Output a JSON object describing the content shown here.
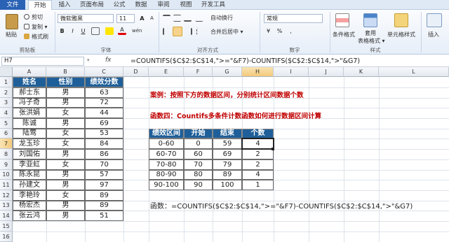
{
  "ribbon": {
    "tabs": [
      "文件",
      "开始",
      "插入",
      "页面布局",
      "公式",
      "数据",
      "审阅",
      "视图",
      "开发工具"
    ],
    "clipboard": {
      "paste": "粘贴",
      "cut": "剪切",
      "copy": "复制 ▾",
      "format_painter": "格式刷",
      "group": "剪贴板"
    },
    "font": {
      "name": "微软雅黑",
      "size": "11",
      "bold": "B",
      "italic": "I",
      "underline": "U",
      "grow": "A",
      "shrink": "A",
      "wen": "wén",
      "group": "字体"
    },
    "alignment": {
      "wrap": "自动换行",
      "merge": "合并后居中 ▾",
      "group": "对齐方式"
    },
    "number": {
      "format": "常规",
      "percent": "%",
      "comma": ",",
      "currency": "¥",
      "group": "数字"
    },
    "styles": {
      "cond": "条件格式",
      "table": "套用",
      "table2": "表格格式 ▾",
      "cell": "单元格样式",
      "group": "样式"
    },
    "insert": "插入"
  },
  "formula_bar": {
    "cell_ref": "H7",
    "fx": "fx",
    "formula": "=COUNTIFS($C$2:$C$14,\">=\"&F7)-COUNTIFS($C$2:$C$14,\">\"&G7)"
  },
  "columns": [
    "A",
    "B",
    "C",
    "D",
    "E",
    "F",
    "G",
    "H",
    "I",
    "J",
    "K",
    "L"
  ],
  "rows": [
    "1",
    "2",
    "3",
    "4",
    "5",
    "6",
    "7",
    "8",
    "9",
    "10",
    "11",
    "12",
    "13",
    "14",
    "15",
    "16"
  ],
  "left_table": {
    "headers": [
      "姓名",
      "性别",
      "绩效分数"
    ],
    "rows": [
      [
        "郝士东",
        "男",
        "63"
      ],
      [
        "冯子奇",
        "男",
        "72"
      ],
      [
        "张洪娟",
        "女",
        "44"
      ],
      [
        "陈诚",
        "男",
        "69"
      ],
      [
        "陆莺",
        "女",
        "53"
      ],
      [
        "龙玉珍",
        "女",
        "84"
      ],
      [
        "刘国佑",
        "男",
        "86"
      ],
      [
        "李亚虹",
        "女",
        "70"
      ],
      [
        "陈永昆",
        "男",
        "57"
      ],
      [
        "孙建文",
        "男",
        "97"
      ],
      [
        "李艳玲",
        "女",
        "89"
      ],
      [
        "杨宏杰",
        "男",
        "89"
      ],
      [
        "张云鸿",
        "男",
        "51"
      ]
    ]
  },
  "case_text": "案例：按照下方的数据区间，分别统计区间数据个数",
  "func_text": "函数四：Countifs多条件计数函数如何进行数据区间计算",
  "right_table": {
    "headers": [
      "绩效区间",
      "开始",
      "结束",
      "个数"
    ],
    "rows": [
      [
        "0-60",
        "0",
        "59",
        "4"
      ],
      [
        "60-70",
        "60",
        "69",
        "2"
      ],
      [
        "70-80",
        "70",
        "79",
        "2"
      ],
      [
        "80-90",
        "80",
        "89",
        "4"
      ],
      [
        "90-100",
        "90",
        "100",
        "1"
      ]
    ]
  },
  "formula_note": "函数：=COUNTIFS($C$2:$C$14,\">=\"&F7)-COUNTIFS($C$2:$C$14,\">\"&G7)",
  "colors": {
    "header_bg": "#1f5f99",
    "accent_red": "#c00000",
    "file_tab": "#2a62b5"
  }
}
